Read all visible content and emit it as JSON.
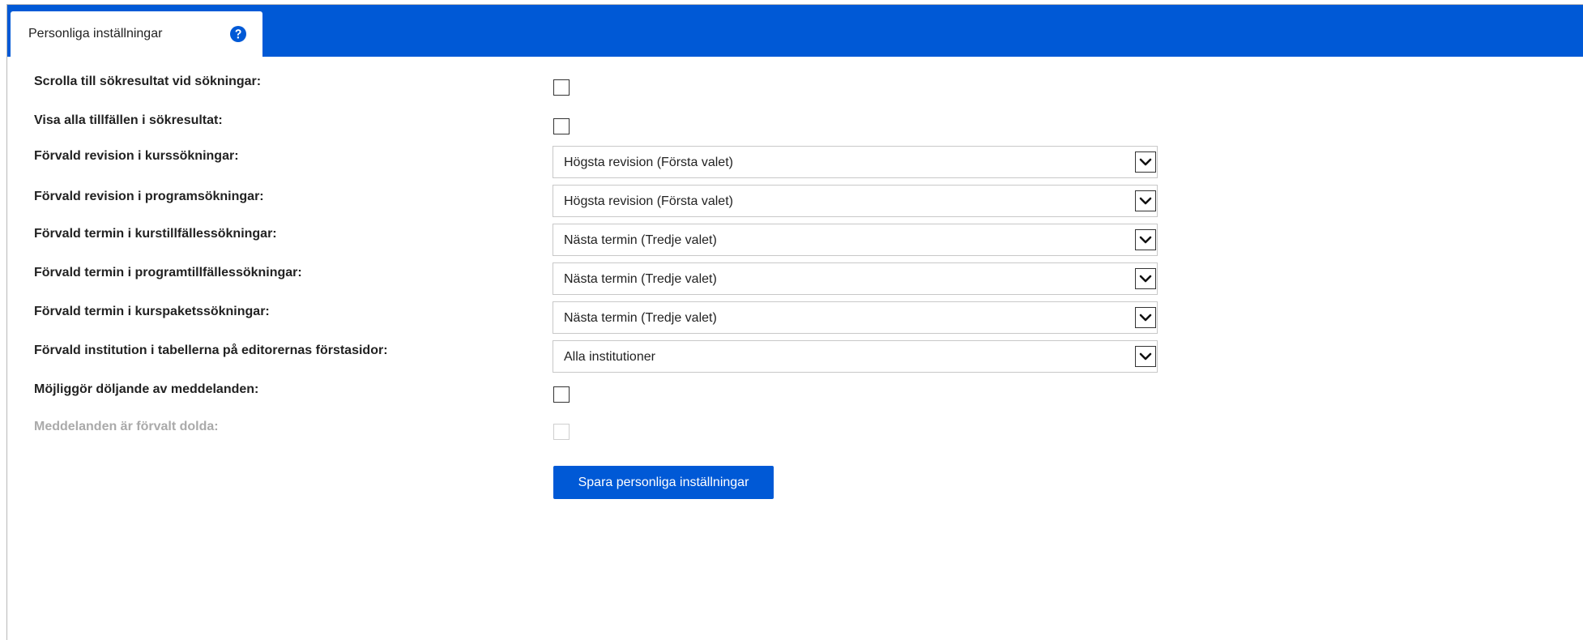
{
  "tab": {
    "label": "Personliga inställningar",
    "help_icon": "question-circle-icon"
  },
  "colors": {
    "accent": "#0059d6",
    "disabled_text": "#aaaaaa"
  },
  "settings": {
    "scroll_to_results": {
      "label": "Scrolla till sökresultat vid sökningar:",
      "checked": false
    },
    "show_all_occasions": {
      "label": "Visa alla tillfällen i sökresultat:",
      "checked": false
    },
    "course_revision": {
      "label": "Förvald revision i kurssökningar:",
      "value": "Högsta revision (Första valet)"
    },
    "program_revision": {
      "label": "Förvald revision i programsökningar:",
      "value": "Högsta revision (Första valet)"
    },
    "course_occasion_term": {
      "label": "Förvald termin i kurstillfällessökningar:",
      "value": "Nästa termin (Tredje valet)"
    },
    "program_occasion_term": {
      "label": "Förvald termin i programtillfällessökningar:",
      "value": "Nästa termin (Tredje valet)"
    },
    "course_package_term": {
      "label": "Förvald termin i kurspaketssökningar:",
      "value": "Nästa termin (Tredje valet)"
    },
    "editor_institution": {
      "label": "Förvald institution i tabellerna på editorernas förstasidor:",
      "value": "Alla institutioner"
    },
    "enable_hide_messages": {
      "label": "Möjliggör döljande av meddelanden:",
      "checked": false
    },
    "messages_hidden_default": {
      "label": "Meddelanden är förvalt dolda:",
      "checked": false,
      "disabled": true
    }
  },
  "actions": {
    "save_label": "Spara personliga inställningar"
  }
}
